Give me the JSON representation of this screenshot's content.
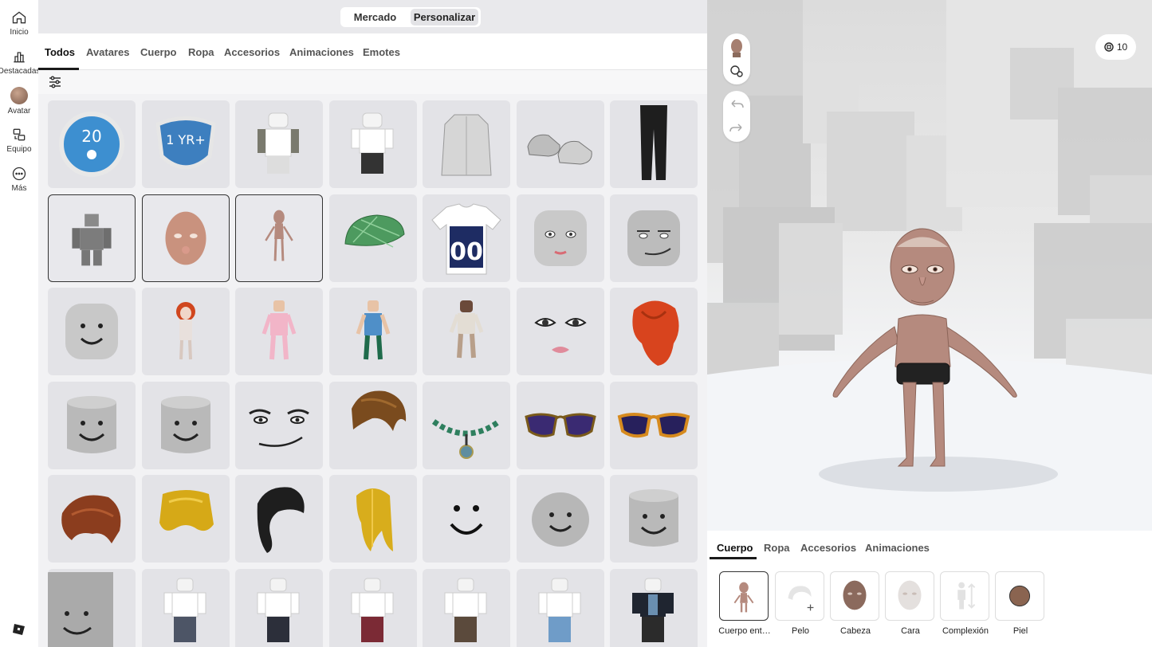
{
  "nav": {
    "items": [
      {
        "label": "Inicio",
        "icon": "home-icon"
      },
      {
        "label": "Destacadas",
        "icon": "chart-icon"
      },
      {
        "label": "Avatar",
        "icon": "avatar-icon"
      },
      {
        "label": "Equipo",
        "icon": "people-icon"
      },
      {
        "label": "Más",
        "icon": "more-icon"
      }
    ]
  },
  "header": {
    "segments": [
      "Mercado",
      "Personalizar"
    ],
    "active_segment": "Personalizar"
  },
  "tabs": [
    "Todos",
    "Avatares",
    "Cuerpo",
    "Ropa",
    "Accesorios",
    "Animaciones",
    "Emotes"
  ],
  "active_tab": "Todos",
  "grid": {
    "items": [
      "20-badge",
      "1-yr-badge",
      "torso-outfit",
      "pants-outfit",
      "lab-coat",
      "sneakers",
      "black-pants",
      "block-body",
      "old-man-head",
      "old-man-body",
      "green-cap",
      "jersey-00",
      "smile-face",
      "smirk-face",
      "default-head",
      "red-hair-avatar",
      "pink-avatar",
      "blue-avatar",
      "zombie-avatar",
      "pink-lips-face",
      "red-hair",
      "cylinder-head",
      "cylinder-head",
      "man-face",
      "brown-hair",
      "jade-necklace",
      "purple-shades",
      "orange-shades",
      "auburn-hair",
      "blonde-pigtails",
      "black-ponytail",
      "long-blonde-hair",
      "smile-decal",
      "round-head",
      "cylinder-head",
      "cube-head",
      "outfit-1",
      "outfit-2",
      "outfit-3",
      "outfit-4",
      "outfit-5",
      "outfit-6"
    ],
    "selected": [
      7,
      8,
      9
    ]
  },
  "viewport": {
    "robux": "10"
  },
  "bottom": {
    "tabs": [
      "Cuerpo",
      "Ropa",
      "Accesorios",
      "Animaciones"
    ],
    "active_tab": "Cuerpo",
    "slots": [
      {
        "label": "Cuerpo ent…"
      },
      {
        "label": "Pelo"
      },
      {
        "label": "Cabeza"
      },
      {
        "label": "Cara"
      },
      {
        "label": "Complexión"
      },
      {
        "label": "Piel"
      }
    ],
    "skin_color": "#8a6450"
  }
}
